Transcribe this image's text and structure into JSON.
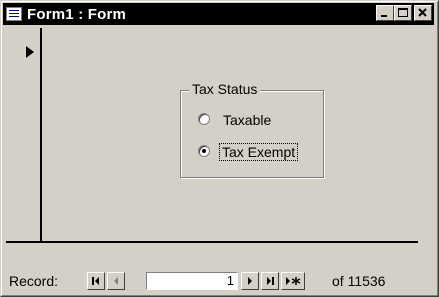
{
  "window": {
    "title": "Form1 : Form",
    "icon": "form-icon",
    "controls": [
      "minimize-icon",
      "maximize-icon",
      "close-icon"
    ]
  },
  "record_selector": {
    "icon": "current-record-arrow-icon"
  },
  "option_group": {
    "label": "Tax Status",
    "options": [
      {
        "label": "Taxable",
        "selected": false
      },
      {
        "label": "Tax Exempt",
        "selected": true
      }
    ]
  },
  "navigation": {
    "label": "Record:",
    "current_record": "1",
    "of_text": "of  11536",
    "buttons": [
      "first-record-icon",
      "previous-record-icon",
      "next-record-icon",
      "last-record-icon",
      "new-record-icon"
    ]
  }
}
